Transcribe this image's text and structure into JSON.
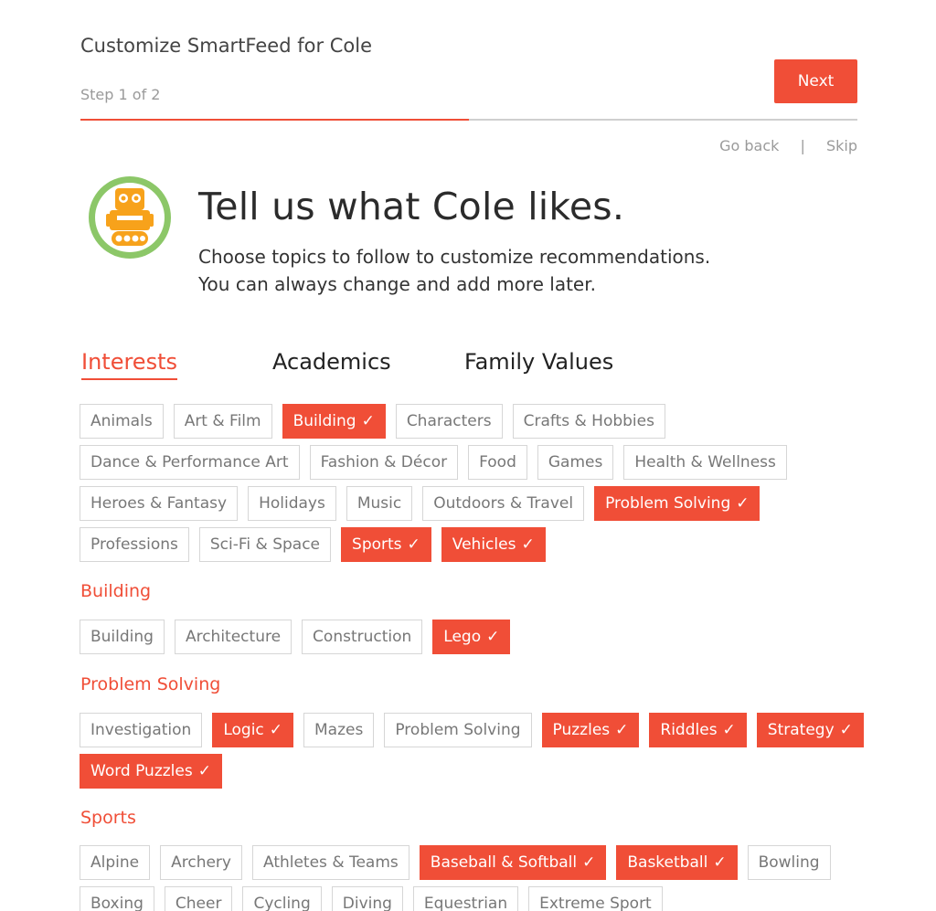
{
  "header": {
    "title": "Customize SmartFeed for Cole",
    "step": "Step 1 of 2",
    "next_label": "Next",
    "progress": 0.5,
    "go_back": "Go back",
    "separator": "|",
    "skip": "Skip"
  },
  "hero": {
    "avatar_icon": "robot-icon",
    "title": "Tell us what Cole likes.",
    "subtitle_line1": "Choose topics to follow to customize recommendations.",
    "subtitle_line2": "You can always change and add more later."
  },
  "colors": {
    "accent": "#f04e37",
    "tag_border": "#d6d6d6",
    "muted_text": "#9a9a9a",
    "avatar_green": "#8cc768",
    "avatar_orange": "#f7a21b"
  },
  "check_mark": "✓",
  "category_tabs": [
    {
      "label": "Interests",
      "active": true
    },
    {
      "label": "Academics",
      "active": false
    },
    {
      "label": "Family Values",
      "active": false
    }
  ],
  "interests": [
    {
      "label": "Animals",
      "selected": false
    },
    {
      "label": "Art & Film",
      "selected": false
    },
    {
      "label": "Building",
      "selected": true
    },
    {
      "label": "Characters",
      "selected": false
    },
    {
      "label": "Crafts & Hobbies",
      "selected": false
    },
    {
      "label": "Dance & Performance Art",
      "selected": false
    },
    {
      "label": "Fashion & Décor",
      "selected": false
    },
    {
      "label": "Food",
      "selected": false
    },
    {
      "label": "Games",
      "selected": false
    },
    {
      "label": "Health & Wellness",
      "selected": false
    },
    {
      "label": "Heroes & Fantasy",
      "selected": false
    },
    {
      "label": "Holidays",
      "selected": false
    },
    {
      "label": "Music",
      "selected": false
    },
    {
      "label": "Outdoors & Travel",
      "selected": false
    },
    {
      "label": "Problem Solving",
      "selected": true
    },
    {
      "label": "Professions",
      "selected": false
    },
    {
      "label": "Sci-Fi & Space",
      "selected": false
    },
    {
      "label": "Sports",
      "selected": true
    },
    {
      "label": "Vehicles",
      "selected": true
    }
  ],
  "subsections": [
    {
      "heading": "Building",
      "tags": [
        {
          "label": "Building",
          "selected": false
        },
        {
          "label": "Architecture",
          "selected": false
        },
        {
          "label": "Construction",
          "selected": false
        },
        {
          "label": "Lego",
          "selected": true
        }
      ]
    },
    {
      "heading": "Problem Solving",
      "tags": [
        {
          "label": "Investigation",
          "selected": false
        },
        {
          "label": "Logic",
          "selected": true
        },
        {
          "label": "Mazes",
          "selected": false
        },
        {
          "label": "Problem Solving",
          "selected": false
        },
        {
          "label": "Puzzles",
          "selected": true
        },
        {
          "label": "Riddles",
          "selected": true
        },
        {
          "label": "Strategy",
          "selected": true
        },
        {
          "label": "Word Puzzles",
          "selected": true
        }
      ]
    },
    {
      "heading": "Sports",
      "tags": [
        {
          "label": "Alpine",
          "selected": false
        },
        {
          "label": "Archery",
          "selected": false
        },
        {
          "label": "Athletes & Teams",
          "selected": false
        },
        {
          "label": "Baseball & Softball",
          "selected": true
        },
        {
          "label": "Basketball",
          "selected": true
        },
        {
          "label": "Bowling",
          "selected": false
        },
        {
          "label": "Boxing",
          "selected": false
        },
        {
          "label": "Cheer",
          "selected": false
        },
        {
          "label": "Cycling",
          "selected": false
        },
        {
          "label": "Diving",
          "selected": false
        },
        {
          "label": "Equestrian",
          "selected": false
        },
        {
          "label": "Extreme Sport",
          "selected": false
        }
      ]
    }
  ]
}
